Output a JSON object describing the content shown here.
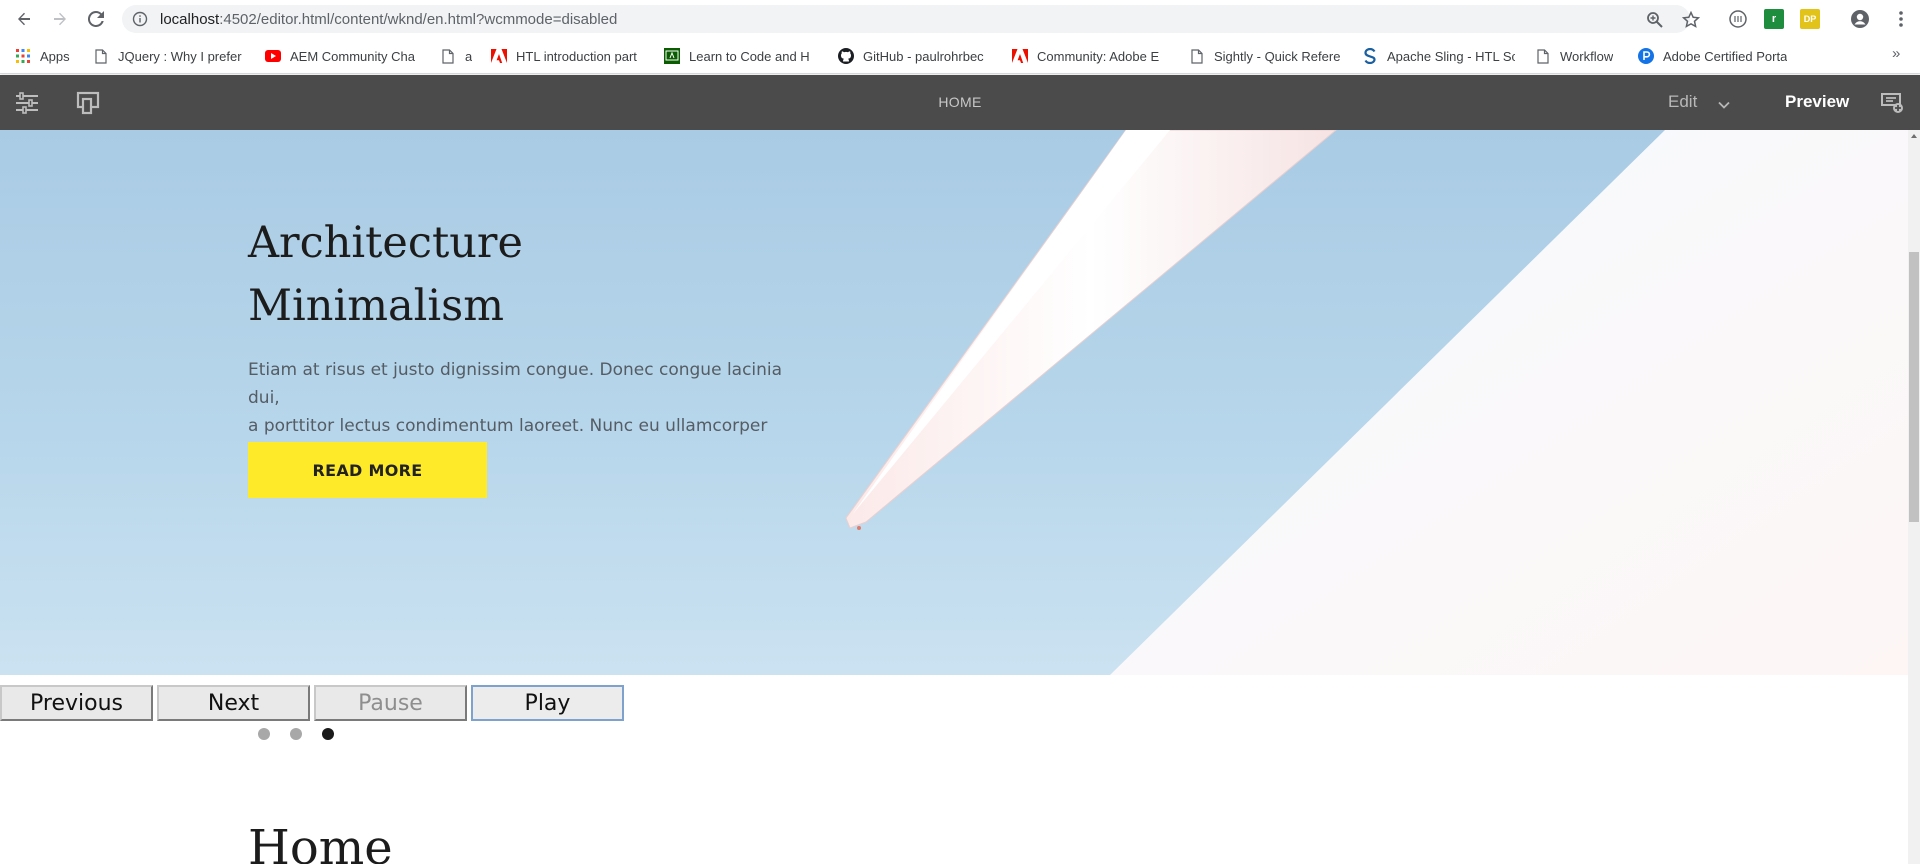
{
  "browser": {
    "url_host": "localhost",
    "url_rest": ":4502/editor.html/content/wknd/en.html?wcmmode=disabled",
    "icons": [
      "back-arrow-icon",
      "forward-arrow-icon",
      "reload-icon",
      "info-icon",
      "zoom-icon",
      "star-icon",
      "extension-icons",
      "profile-icon",
      "menu-icon"
    ],
    "extensions": {
      "ext2": "r",
      "ext3": "DP"
    }
  },
  "bookmarks": {
    "apps": "Apps",
    "items": [
      {
        "label": "JQuery : Why I prefer"
      },
      {
        "label": "AEM Community Cha"
      },
      {
        "label": "a"
      },
      {
        "label": "HTL introduction part"
      },
      {
        "label": "Learn to Code and H"
      },
      {
        "label": "GitHub - paulrohrbec"
      },
      {
        "label": "Community: Adobe E"
      },
      {
        "label": "Sightly - Quick Refere"
      },
      {
        "label": "Apache Sling - HTL Sc"
      },
      {
        "label": "Workflow"
      },
      {
        "label": "Adobe Certified Porta"
      }
    ],
    "more": "»"
  },
  "aem_toolbar": {
    "title": "HOME",
    "edit_label": "Edit",
    "preview_label": "Preview",
    "icons": [
      "properties-icon",
      "emulator-icon",
      "annotations-icon"
    ]
  },
  "hero": {
    "title_line1": "Architecture",
    "title_line2": "Minimalism",
    "description_line1": "Etiam at risus et justo dignissim congue. Donec congue lacinia dui,",
    "description_line2": "a porttitor lectus condimentum laoreet. Nunc eu ullamcorper orci.",
    "cta_label": "READ MORE",
    "colors": {
      "sky": "#a9cbe4",
      "cta": "#ffea2a"
    }
  },
  "carousel": {
    "previous_label": "Previous",
    "next_label": "Next",
    "pause_label": "Pause",
    "play_label": "Play",
    "indicators": 3,
    "active_index": 2
  },
  "page": {
    "heading": "Home"
  }
}
